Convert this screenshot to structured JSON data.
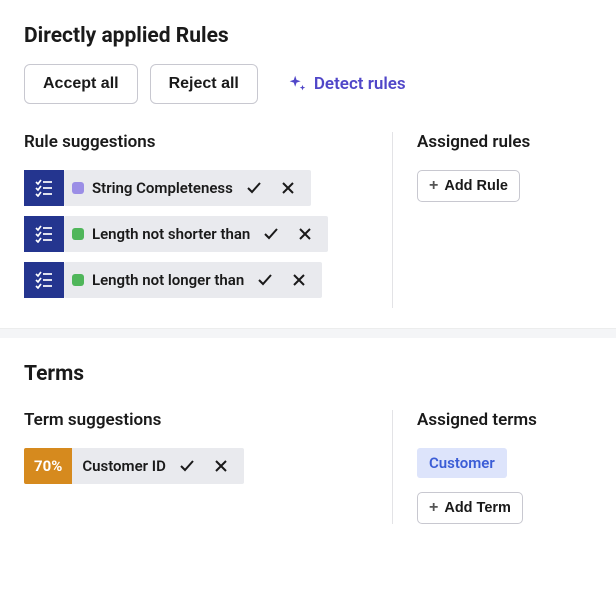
{
  "rules_section": {
    "title": "Directly applied Rules",
    "accept_all_label": "Accept all",
    "reject_all_label": "Reject all",
    "detect_label": "Detect rules",
    "suggestions_title": "Rule suggestions",
    "assigned_title": "Assigned rules",
    "add_rule_label": "Add Rule",
    "suggestions": [
      {
        "label": "String Completeness",
        "color": "purple"
      },
      {
        "label": "Length not shorter than",
        "color": "green"
      },
      {
        "label": "Length not longer than",
        "color": "green"
      }
    ]
  },
  "terms_section": {
    "title": "Terms",
    "suggestions_title": "Term suggestions",
    "assigned_title": "Assigned terms",
    "add_term_label": "Add Term",
    "suggestions": [
      {
        "pct": "70%",
        "label": "Customer ID"
      }
    ],
    "assigned": [
      {
        "label": "Customer"
      }
    ]
  }
}
